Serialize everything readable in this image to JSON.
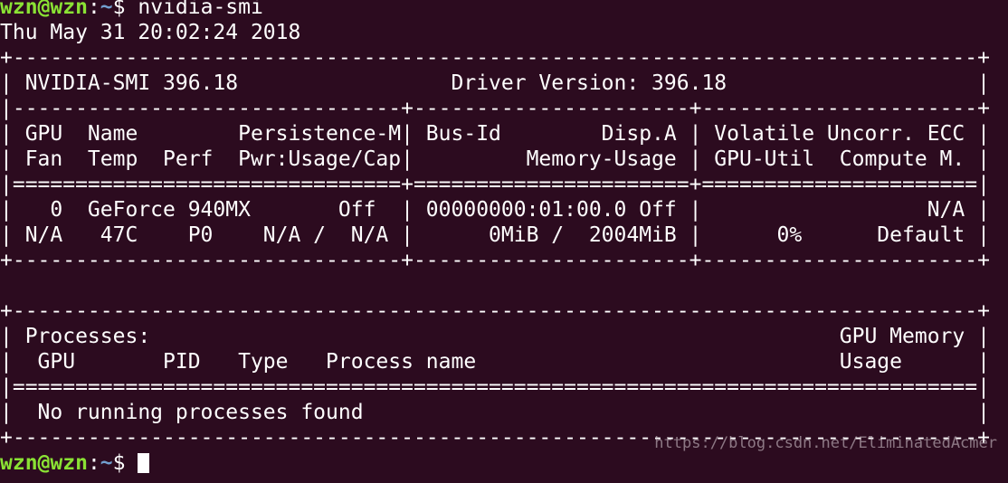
{
  "prompt": {
    "user_host": "wzn@wzn",
    "colon": ":",
    "path": "~",
    "symbol": "$ ",
    "command": "nvidia-smi"
  },
  "timestamp": "Thu May 31 20:02:24 2018",
  "output_lines": [
    "+-----------------------------------------------------------------------------+",
    "| NVIDIA-SMI 396.18                 Driver Version: 396.18                    |",
    "|-------------------------------+----------------------+----------------------+",
    "| GPU  Name        Persistence-M| Bus-Id        Disp.A | Volatile Uncorr. ECC |",
    "| Fan  Temp  Perf  Pwr:Usage/Cap|         Memory-Usage | GPU-Util  Compute M. |",
    "|===============================+======================+======================|",
    "|   0  GeForce 940MX       Off  | 00000000:01:00.0 Off |                  N/A |",
    "| N/A   47C    P0    N/A /  N/A |      0MiB /  2004MiB |      0%      Default |",
    "+-------------------------------+----------------------+----------------------+",
    "",
    "+-----------------------------------------------------------------------------+",
    "| Processes:                                                       GPU Memory |",
    "|  GPU       PID   Type   Process name                             Usage      |",
    "|=============================================================================|",
    "|  No running processes found                                                 |",
    "+-----------------------------------------------------------------------------+"
  ],
  "watermark": "https://blog.csdn.net/EliminatedAcmer",
  "colors": {
    "background": "#2c0b1f",
    "text": "#ffffff",
    "prompt_user": "#8ae234",
    "prompt_path": "#729fcf"
  }
}
